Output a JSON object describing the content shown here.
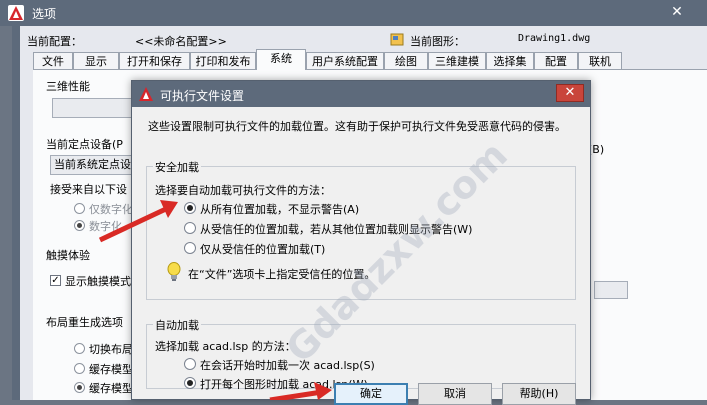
{
  "options_window": {
    "title": "选项",
    "close_symbol": "✕",
    "current_config_label": "当前配置：",
    "current_config_value": "<<未命名配置>>",
    "current_drawing_label": "当前图形：",
    "current_drawing_value": "Drawing1.dwg",
    "tabs": [
      {
        "label": "文件",
        "active": false
      },
      {
        "label": "显示",
        "active": false
      },
      {
        "label": "打开和保存",
        "active": false
      },
      {
        "label": "打印和发布",
        "active": false
      },
      {
        "label": "系统",
        "active": true
      },
      {
        "label": "用户系统配置",
        "active": false
      },
      {
        "label": "绘图",
        "active": false
      },
      {
        "label": "三维建模",
        "active": false
      },
      {
        "label": "选择集",
        "active": false
      },
      {
        "label": "配置",
        "active": false
      },
      {
        "label": "联机",
        "active": false
      }
    ],
    "system_tab": {
      "perf3d_title": "三维性能",
      "pointing_title": "当前定点设备(P",
      "pointing_value": "当前系统定点设",
      "accept_input_label": "接受来自以下设",
      "digitizer_only": "仅数字化",
      "digitizer_and_mouse": "数字化",
      "right_fragment": "(B)",
      "touch_title": "触摸体验",
      "touch_checkbox": "显示触摸模式",
      "layout_regen_title": "布局重生成选项",
      "layout_opt1": "切换布局",
      "layout_opt2": "缓存模型",
      "layout_opt3": "缓存模型"
    }
  },
  "dialog": {
    "title": "可执行文件设置",
    "close_symbol": "✕",
    "description": "这些设置限制可执行文件的加载位置。这有助于保护可执行文件免受恶意代码的侵害。",
    "security_group": {
      "legend": "安全加载",
      "prompt": "选择要自动加载可执行文件的方法：",
      "options": [
        {
          "label": "从所有位置加载，不显示警告(A)",
          "selected": true
        },
        {
          "label": "从受信任的位置加载，若从其他位置加载则显示警告(W)",
          "selected": false
        },
        {
          "label": "仅从受信任的位置加载(T)",
          "selected": false
        }
      ],
      "hint": "在“文件”选项卡上指定受信任的位置。",
      "hint_icon": "lightbulb-icon"
    },
    "autoload_group": {
      "legend": "自动加载",
      "prompt": "选择加载 acad.lsp 的方法：",
      "options": [
        {
          "label": "在会话开始时加载一次 acad.lsp(S)",
          "selected": false
        },
        {
          "label": "打开每个图形时加载 acad.lsp(W)",
          "selected": true
        }
      ]
    },
    "buttons": {
      "ok": "确定",
      "cancel": "取消",
      "help": "帮助(H)"
    }
  },
  "watermark": "Gdadzxw.com",
  "colors": {
    "titlebar": "#5d6a7b",
    "close_red": "#c9453b",
    "annotation_arrow": "#d92a25",
    "default_button_border": "#3c7fb1"
  }
}
